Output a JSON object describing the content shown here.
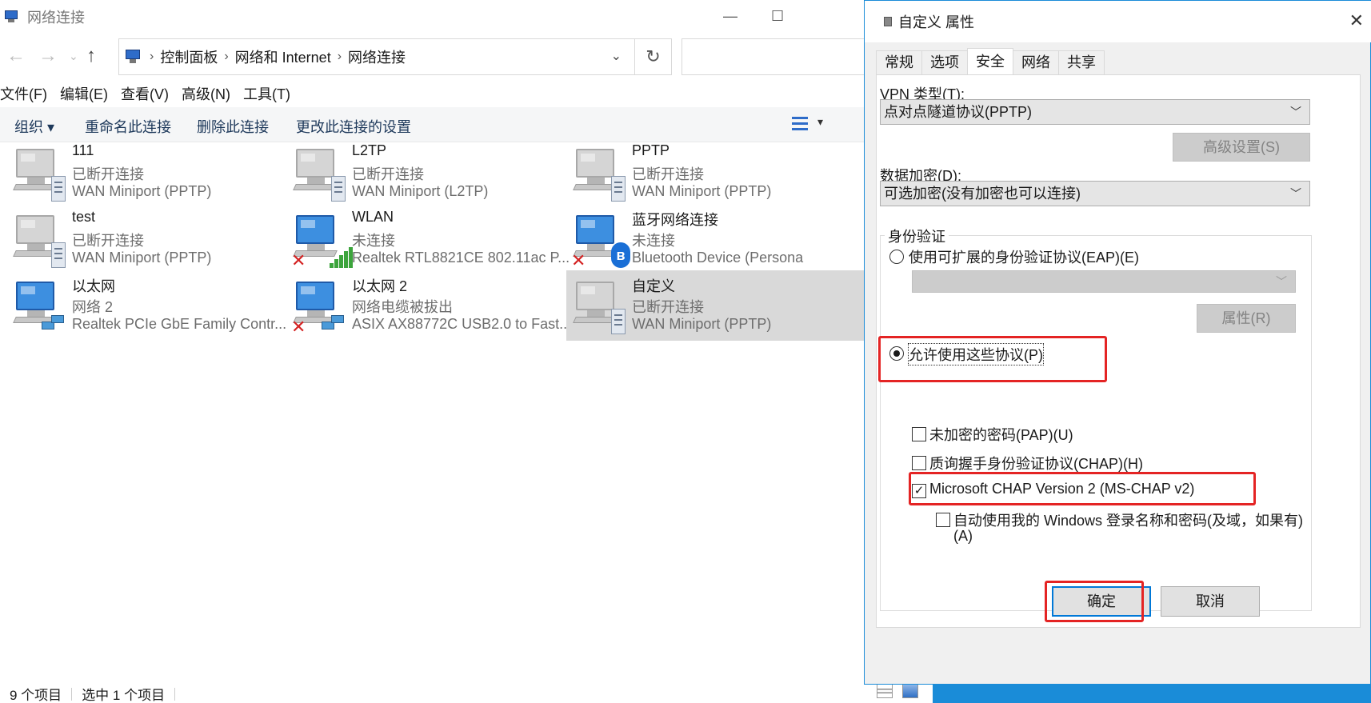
{
  "explorer": {
    "title": "网络连接",
    "breadcrumb": [
      "控制面板",
      "网络和 Internet",
      "网络连接"
    ],
    "menu": [
      "文件(F)",
      "编辑(E)",
      "查看(V)",
      "高级(N)",
      "工具(T)"
    ],
    "toolbar": {
      "organize": "组织 ▾",
      "rename": "重命名此连接",
      "delete": "删除此连接",
      "change_settings": "更改此连接的设置"
    },
    "items": [
      {
        "name": "111",
        "status": "已断开连接",
        "device": "WAN Miniport (PPTP)"
      },
      {
        "name": "L2TP",
        "status": "已断开连接",
        "device": "WAN Miniport (L2TP)"
      },
      {
        "name": "PPTP",
        "status": "已断开连接",
        "device": "WAN Miniport (PPTP)"
      },
      {
        "name": "test",
        "status": "已断开连接",
        "device": "WAN Miniport (PPTP)"
      },
      {
        "name": "WLAN",
        "status": "未连接",
        "device": "Realtek RTL8821CE 802.11ac P..."
      },
      {
        "name": "蓝牙网络连接",
        "status": "未连接",
        "device": "Bluetooth Device (Persona"
      },
      {
        "name": "以太网",
        "status": "网络 2",
        "device": "Realtek PCIe GbE Family Contr..."
      },
      {
        "name": "以太网 2",
        "status": "网络电缆被拔出",
        "device": "ASIX AX88772C USB2.0 to Fast..."
      },
      {
        "name": "自定义",
        "status": "已断开连接",
        "device": "WAN Miniport (PPTP)"
      }
    ],
    "statusbar": {
      "count": "9 个项目",
      "selected": "选中 1 个项目"
    }
  },
  "dialog": {
    "title": "自定义 属性",
    "tabs": [
      "常规",
      "选项",
      "安全",
      "网络",
      "共享"
    ],
    "active_tab": "安全",
    "vpn_type_label": "VPN 类型(T):",
    "vpn_type_value": "点对点隧道协议(PPTP)",
    "advanced_button": "高级设置(S)",
    "encryption_label": "数据加密(D):",
    "encryption_value": "可选加密(没有加密也可以连接)",
    "auth_group": "身份验证",
    "eap_radio": "使用可扩展的身份验证协议(EAP)(E)",
    "eap_properties_button": "属性(R)",
    "allow_radio": "允许使用这些协议(P)",
    "pap_check": "未加密的密码(PAP)(U)",
    "chap_check": "质询握手身份验证协议(CHAP)(H)",
    "mschap_check": "Microsoft CHAP Version 2 (MS-CHAP v2)",
    "auto_logon_line1": "自动使用我的 Windows 登录名称和密码(及域，如果有)",
    "auto_logon_line2": "(A)",
    "ok_button": "确定",
    "cancel_button": "取消"
  },
  "colors": {
    "accent": "#0078d7",
    "highlight_box": "#e42424",
    "desktop_blue": "#1a8cd8"
  }
}
